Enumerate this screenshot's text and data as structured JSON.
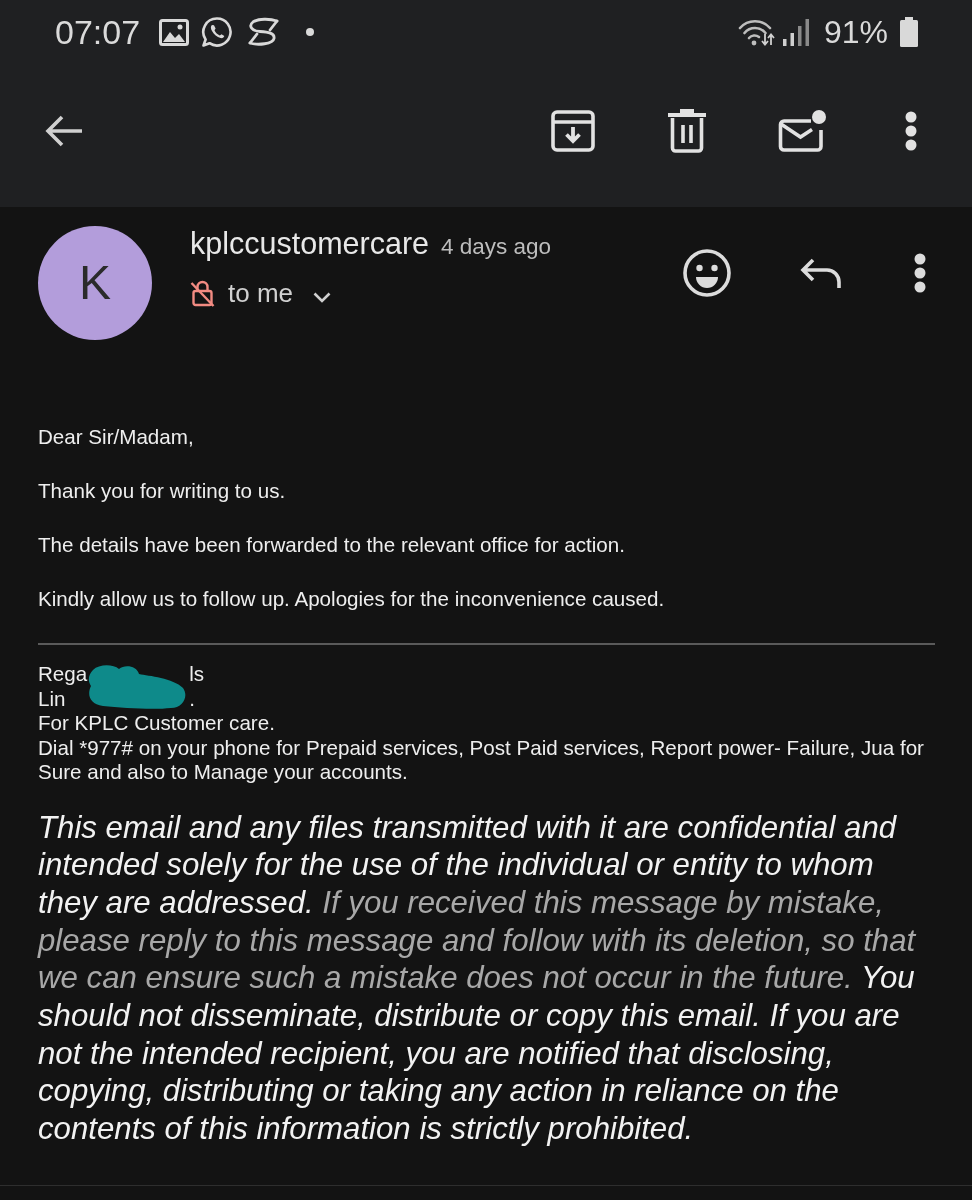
{
  "status_bar": {
    "time": "07:07",
    "battery": "91%"
  },
  "message": {
    "avatar_letter": "K",
    "sender": "kplccustomercare",
    "time": "4 days ago",
    "recipient": "to me"
  },
  "body": {
    "paragraphs": [
      "Dear Sir/Madam,",
      "Thank you for writing to us.",
      "The details have been forwarded to the relevant office for action.",
      "Kindly allow us to follow up. Apologies for the inconvenience caused."
    ],
    "signature": {
      "redacted_lines": [
        [
          "Rega",
          "ls"
        ],
        [
          "Lin",
          "."
        ]
      ],
      "lines": [
        "For KPLC Customer care.",
        "Dial *977# on your phone for Prepaid services, Post Paid services, Report power- Failure, Jua for Sure and also to Manage your accounts."
      ]
    },
    "disclaimer": [
      {
        "kind": "plain",
        "text": "This email and any files transmitted with it are confidential and intended solely for the use of the individual or entity to whom they are addressed."
      },
      {
        "kind": "muted",
        "text": "If you received this message by mistake, please reply to this message and follow with its deletion, so that we can ensure such a mistake does not occur in the future."
      },
      {
        "kind": "plain",
        "text": "You should not disseminate, distribute or copy this email. If you are not the intended recipient, you are notified that disclosing, copying, distributing or taking any action in reliance on the contents of this information is strictly prohibited."
      }
    ]
  }
}
